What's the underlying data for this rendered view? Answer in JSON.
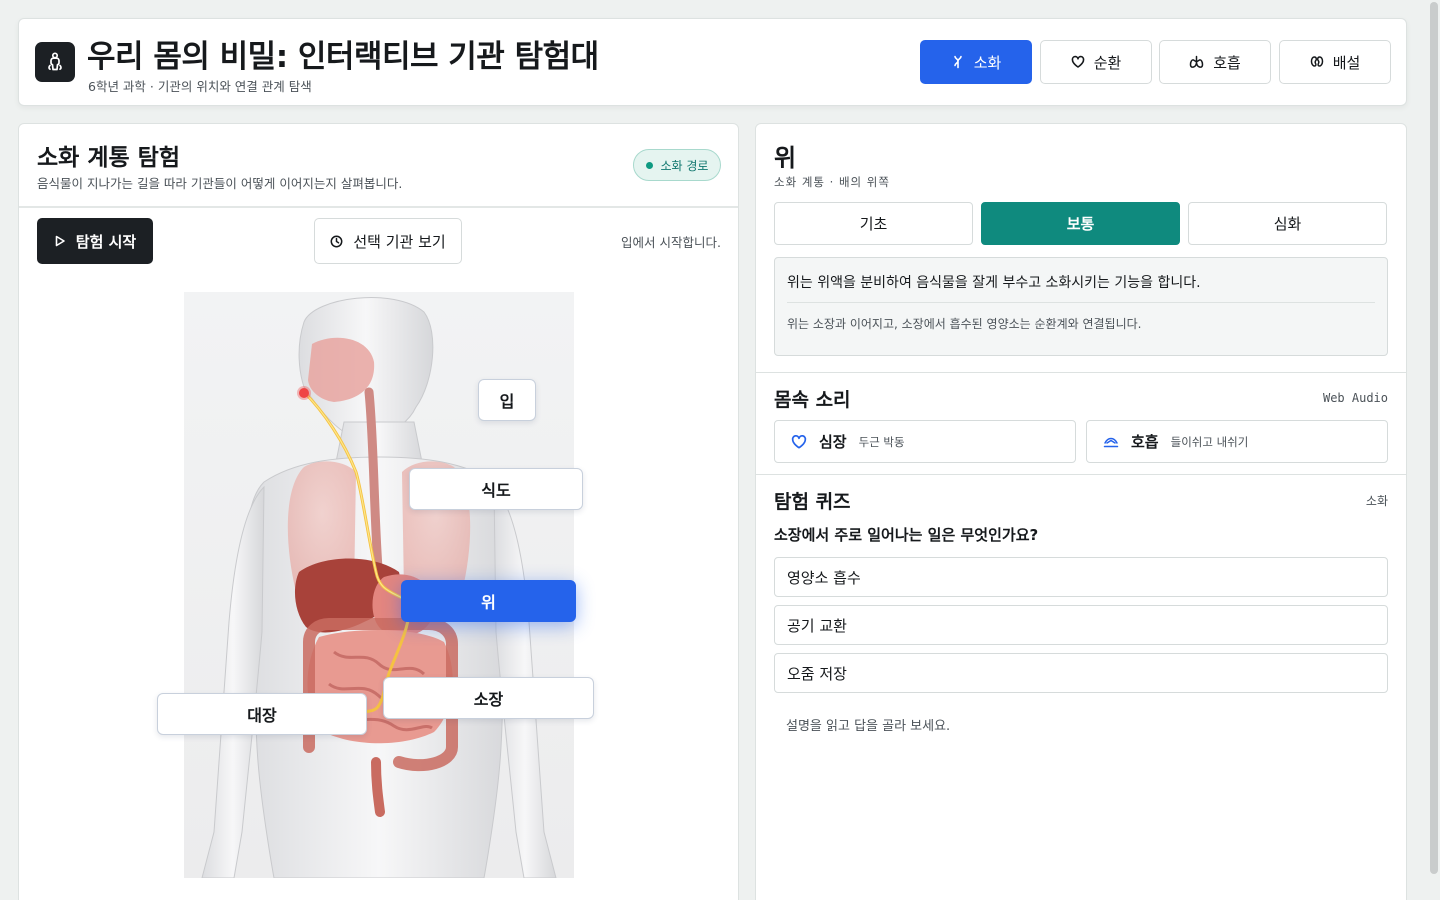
{
  "header": {
    "title": "우리 몸의 비밀: 인터랙티브 기관 탐험대",
    "subtitle": "6학년 과학 · 기관의 위치와 연결 관계 탐색",
    "systems": [
      {
        "label": "소화",
        "icon": "digestion-icon",
        "active": true
      },
      {
        "label": "순환",
        "icon": "heart-icon",
        "active": false
      },
      {
        "label": "호흡",
        "icon": "lungs-icon",
        "active": false
      },
      {
        "label": "배설",
        "icon": "kidney-icon",
        "active": false
      }
    ]
  },
  "explorer": {
    "title": "소화 계통 탐험",
    "subtitle": "음식물이 지나가는 길을 따라 기관들이 어떻게 이어지는지 살펴봅니다.",
    "route_badge": "소화 경로",
    "start_label": "탐험 시작",
    "view_label": "선택 기관 보기",
    "status": "입에서 시작합니다.",
    "organs": [
      {
        "label": "입",
        "active": false
      },
      {
        "label": "식도",
        "active": false
      },
      {
        "label": "위",
        "active": true
      },
      {
        "label": "소장",
        "active": false
      },
      {
        "label": "대장",
        "active": false
      }
    ]
  },
  "detail": {
    "title": "위",
    "subtitle": "소화 계통 · 배의 위쪽",
    "levels": [
      {
        "label": "기초",
        "active": false
      },
      {
        "label": "보통",
        "active": true
      },
      {
        "label": "심화",
        "active": false
      }
    ],
    "description": "위는 위액을 분비하여 음식물을 잘게 부수고 소화시키는 기능을 합니다.",
    "connection": "위는 소장과 이어지고, 소장에서 흡수된 영양소는 순환계와 연결됩니다."
  },
  "sounds": {
    "title": "몸속 소리",
    "meta": "Web Audio",
    "items": [
      {
        "name": "심장",
        "desc": "두근 박동",
        "icon": "heart-icon"
      },
      {
        "name": "호흡",
        "desc": "들이쉬고 내쉬기",
        "icon": "breath-icon"
      }
    ]
  },
  "quiz": {
    "title": "탐험 퀴즈",
    "meta": "소화",
    "question": "소장에서 주로 일어나는 일은 무엇인가요?",
    "options": [
      "영양소 흡수",
      "공기 교환",
      "오줌 저장"
    ],
    "hint": "설명을 읽고 답을 골라 보세요."
  },
  "colors": {
    "accent": "#2563eb",
    "teal": "#0f8a7e",
    "dark": "#1c2024",
    "path": "#f5c242",
    "mouth_dot": "#ef4444"
  }
}
